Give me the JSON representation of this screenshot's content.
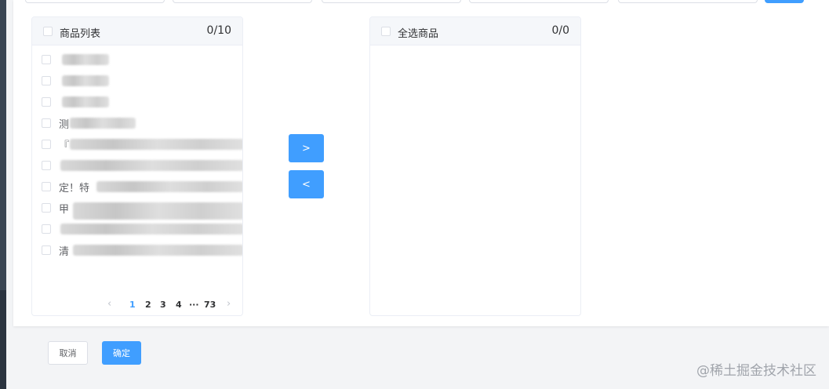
{
  "transfer": {
    "left": {
      "title": "商品列表",
      "count": "0/10",
      "items": [
        "",
        "",
        "",
        "测",
        "『",
        "",
        "定！特",
        "甲",
        "",
        "清"
      ]
    },
    "right": {
      "title": "全选商品",
      "count": "0/0"
    },
    "to_right_label": ">",
    "to_left_label": "<"
  },
  "pagination": {
    "prev_icon": "chevron-left-icon",
    "pages": [
      "1",
      "2",
      "3",
      "4"
    ],
    "ellipsis": "···",
    "last_page": "73",
    "next_icon": "chevron-right-icon",
    "active_page": "1"
  },
  "footer": {
    "cancel_label": "取消",
    "confirm_label": "确定"
  },
  "watermark": "@稀土掘金技术社区",
  "colors": {
    "primary": "#409eff",
    "border": "#ebeef5",
    "header_bg": "#f5f7fa",
    "page_bg": "#f3f4f6"
  }
}
